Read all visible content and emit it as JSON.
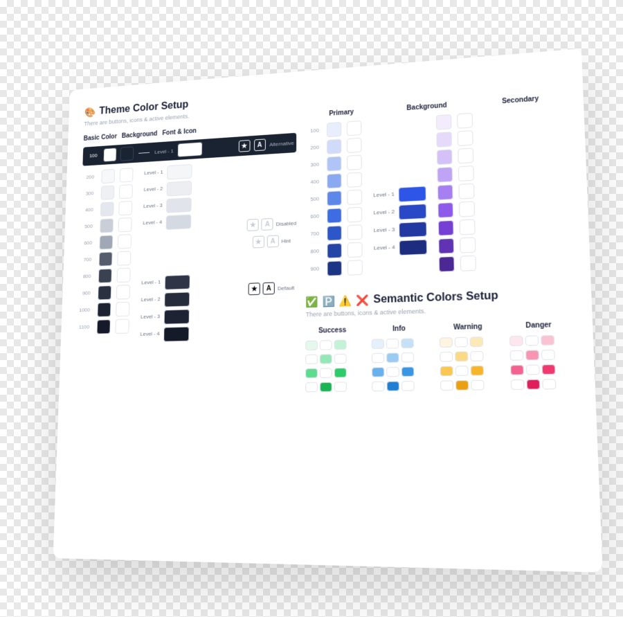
{
  "theme": {
    "title": "Theme Color Setup",
    "sub": "There are buttons, icons & active elements.",
    "cols": {
      "basic": "Basic Color",
      "bg": "Background",
      "fi": "Font & Icon",
      "primary": "Primary",
      "bg2": "Background",
      "secondary": "Secondary"
    },
    "nums": [
      "100",
      "200",
      "300",
      "400",
      "500",
      "600",
      "700",
      "800",
      "900",
      "1000",
      "1100"
    ],
    "nums9": [
      "100",
      "200",
      "300",
      "400",
      "500",
      "600",
      "700",
      "800",
      "900"
    ],
    "levels": [
      "Level - 1",
      "Level - 2",
      "Level - 3",
      "Level - 4"
    ],
    "states": {
      "alt": "Alternative",
      "disabled": "Disabled",
      "hint": "Hint",
      "default": "Default"
    },
    "basic": [
      "#ffffff",
      "#f7f8fa",
      "#eef0f4",
      "#e4e7ed",
      "#c9ced8",
      "#a1a8b5",
      "#555c6b",
      "#3a4151",
      "#2a3040",
      "#1e2331",
      "#15192a"
    ],
    "bgL": [
      "#f5f6f8",
      "#eceef2",
      "#e1e4ea",
      "#d5dae2"
    ],
    "bgD": [
      "#2f3546",
      "#262c3c",
      "#1d2332",
      "#151a28"
    ],
    "primary": [
      "#e8eefc",
      "#cfdbf9",
      "#b0c5f5",
      "#8aa9f0",
      "#5e87ea",
      "#3e6de3",
      "#2d56c8",
      "#2444a6",
      "#1c3584"
    ],
    "bg2L": [
      "#2d56e8",
      "#2848c6",
      "#2239a2",
      "#1c2d80"
    ],
    "secondary": [
      "#f3ecfd",
      "#e6dafb",
      "#d4c1f8",
      "#bfa3f5",
      "#a67ff0",
      "#8d5aea",
      "#7640d4",
      "#6033b4",
      "#4b2894"
    ]
  },
  "sem": {
    "title": "Semantic Colors Setup",
    "sub": "There are buttons, icons & active elements.",
    "cols": {
      "s": "Success",
      "i": "Info",
      "w": "Warning",
      "d": "Danger"
    },
    "success": [
      "#e4f9ec",
      "#c3f2d5",
      "#95e8b5",
      "#5ddb8e",
      "#2fcb6a",
      "#1ab553"
    ],
    "info": [
      "#e4f0fb",
      "#c5e0f7",
      "#9acbf2",
      "#67b1ec",
      "#3a96e4",
      "#1f7fd4"
    ],
    "warning": [
      "#fef5e0",
      "#fde9b8",
      "#fcd985",
      "#fac752",
      "#f7b52a",
      "#eaa010"
    ],
    "danger": [
      "#fde6ed",
      "#fac3d4",
      "#f795b3",
      "#f36390",
      "#ee3a71",
      "#e01f5a"
    ]
  }
}
